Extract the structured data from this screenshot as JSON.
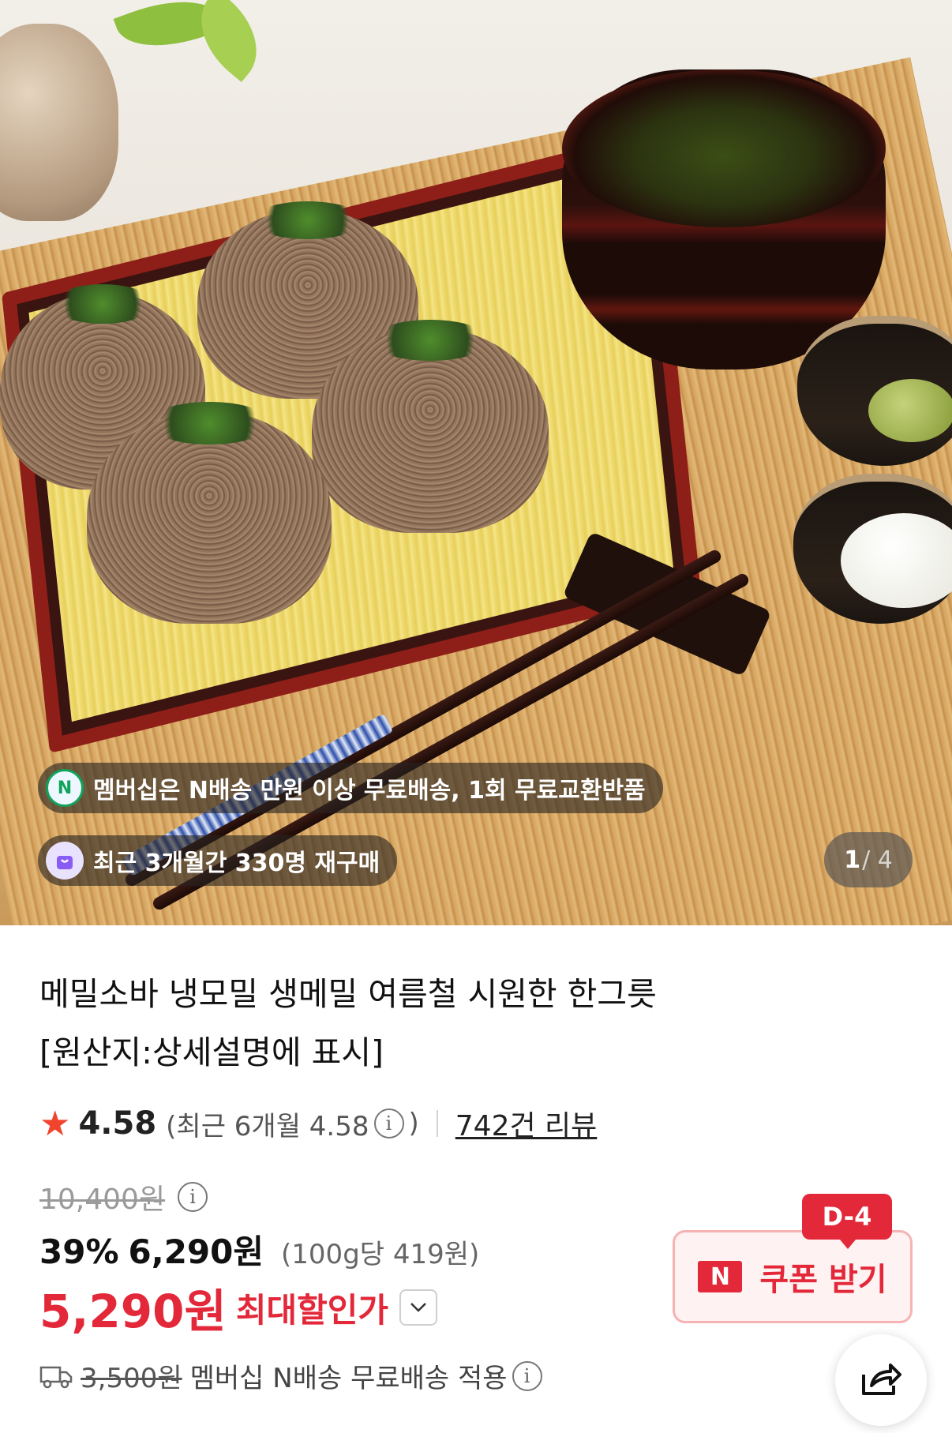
{
  "hero": {
    "badges": [
      {
        "icon": "n-delivery-icon",
        "text": "멤버십은 N배송 만원 이상 무료배송, 1회 무료교환반품"
      },
      {
        "icon": "shopping-bag-icon",
        "text": "최근 3개월간 330명 재구매"
      }
    ],
    "counter": {
      "current": "1",
      "total": "/ 4"
    }
  },
  "product": {
    "title_line1": "메밀소바 냉모밀 생메밀 여름철 시원한 한그릇",
    "title_line2": "[원산지:상세설명에 표시]"
  },
  "rating": {
    "score": "4.58",
    "recent_prefix": "(최근 6개월 4.58",
    "recent_suffix": ")",
    "reviews": "742건 리뷰"
  },
  "pricing": {
    "original": "10,400원",
    "discount_rate": "39%",
    "sale_price": "6,290원",
    "unit_price": "(100g당 419원)",
    "max_discount_price": "5,290원",
    "max_discount_label": "최대할인가"
  },
  "coupon": {
    "dday": "D-4",
    "badge": "N",
    "label": "쿠폰 받기"
  },
  "shipping": {
    "original_fee": "3,500원",
    "text": "멤버십 N배송 무료배송 적용"
  },
  "colors": {
    "accent_red": "#e3283a",
    "star": "#f0442f"
  }
}
